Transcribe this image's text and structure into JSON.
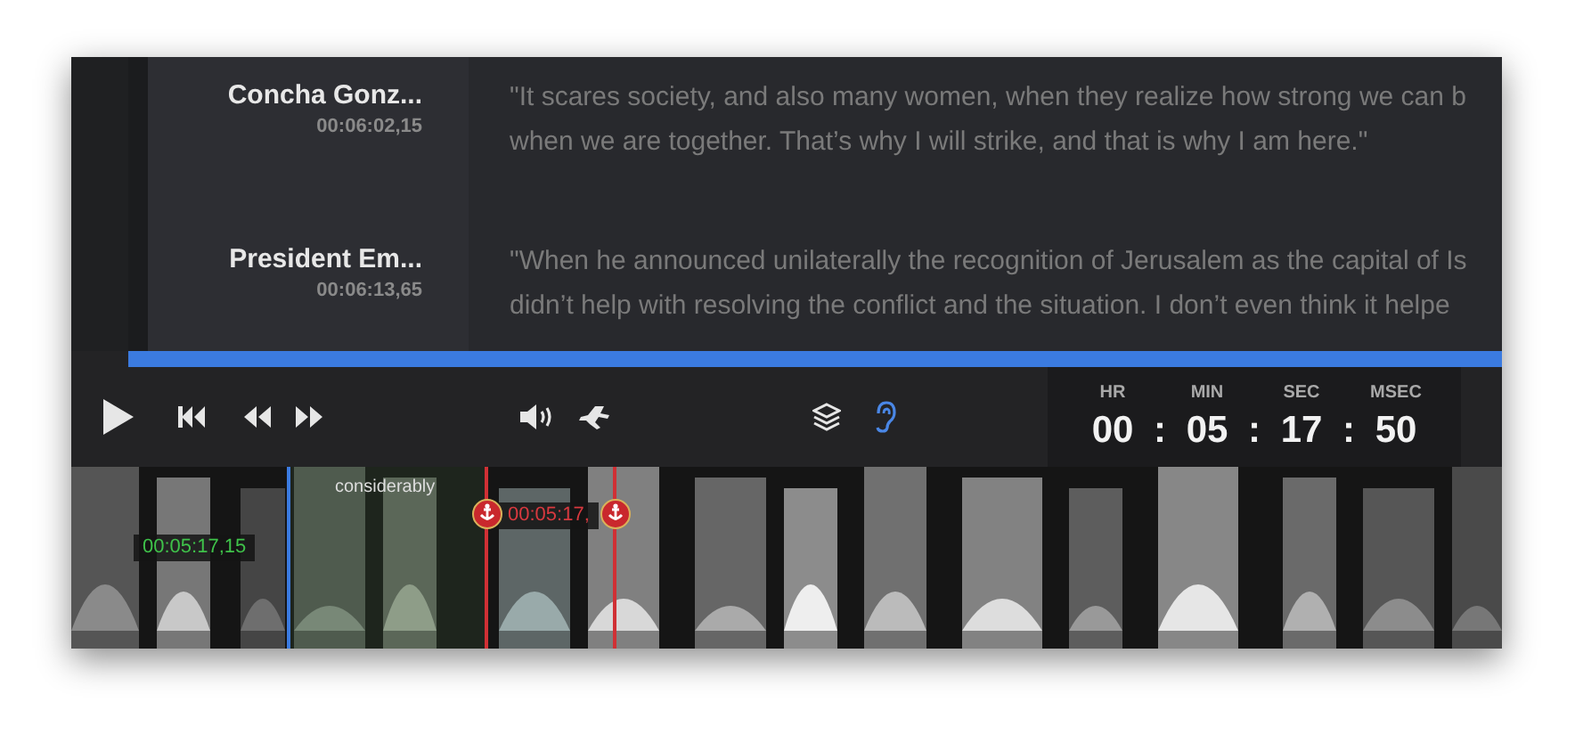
{
  "transcript": [
    {
      "speaker": "Concha Gonz...",
      "time": "00:06:02,15",
      "lines": [
        "\"It scares society, and also many women, when they realize how strong we can b",
        "when we are together. That’s why I will strike, and that is why I am here.\""
      ]
    },
    {
      "speaker": "President Em...",
      "time": "00:06:13,65",
      "lines": [
        "\"When he announced unilaterally the recognition of Jerusalem as the capital of Is",
        "didn’t help with resolving the conflict and the situation. I don’t even think it helpe"
      ]
    }
  ],
  "progress": {
    "level": 1
  },
  "player": {
    "buttons": [
      {
        "kind": "play",
        "active": false
      },
      {
        "kind": "skip-back",
        "active": false
      },
      {
        "kind": "rewind",
        "active": false
      },
      {
        "kind": "forward",
        "active": false
      },
      {
        "kind": "volume",
        "active": false
      },
      {
        "kind": "speed",
        "active": false
      },
      {
        "kind": "layers",
        "active": false
      },
      {
        "kind": "ear",
        "active": true
      }
    ]
  },
  "timecode": {
    "units": [
      {
        "label": "HR",
        "value": "00"
      },
      {
        "label": "MIN",
        "value": "05"
      },
      {
        "label": "SEC",
        "value": "17"
      },
      {
        "label": "MSEC",
        "value": "50"
      }
    ],
    "separator": ":"
  },
  "spectrogram": {
    "kind": "picture",
    "cursor_time": "00:05:17,15",
    "segment_word": "considerably",
    "selection_time": "00:05:17,"
  }
}
